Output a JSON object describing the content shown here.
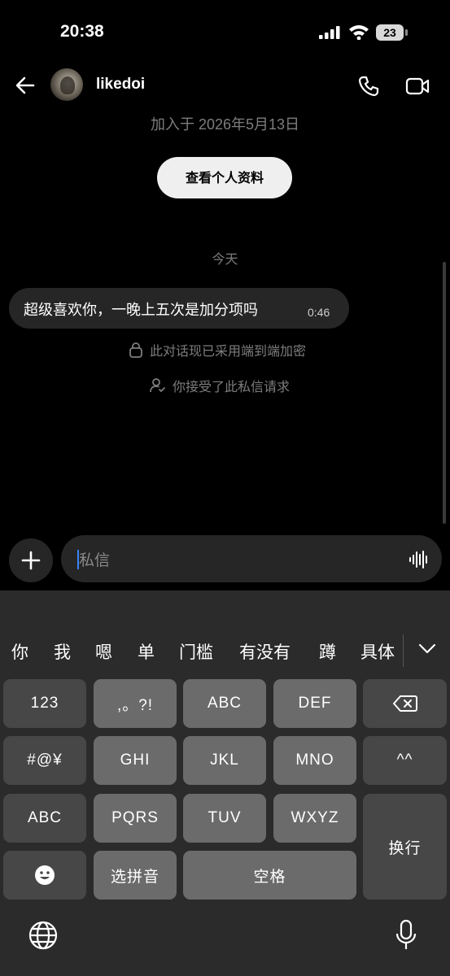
{
  "status_bar": {
    "time": "20:38",
    "battery": "23"
  },
  "header": {
    "username": "likedoi"
  },
  "chat": {
    "joined_text": "加入于 2026年5月13日",
    "profile_button": "查看个人资料",
    "date_separator": "今天",
    "messages": [
      {
        "text": "超级喜欢你，一晚上五次是加分项吗",
        "time": "0:46"
      }
    ],
    "system_notes": [
      {
        "icon": "lock-icon",
        "text": "此对话现已采用端到端加密"
      },
      {
        "icon": "person-check-icon",
        "text": "你接受了此私信请求"
      }
    ]
  },
  "composer": {
    "placeholder": "私信"
  },
  "keyboard": {
    "candidates": [
      "你",
      "我",
      "嗯",
      "单",
      "门槛",
      "有没有",
      "蹲",
      "具体"
    ],
    "keys": {
      "k123": "123",
      "punct": ",。?!",
      "abc": "ABC",
      "def": "DEF",
      "symbols": "#@¥",
      "ghi": "GHI",
      "jkl": "JKL",
      "mno": "MNO",
      "kaomoji": "^^",
      "abc_mode": "ABC",
      "pqrs": "PQRS",
      "tuv": "TUV",
      "wxyz": "WXYZ",
      "return": "换行",
      "pinyin": "选拼音",
      "space": "空格"
    }
  }
}
